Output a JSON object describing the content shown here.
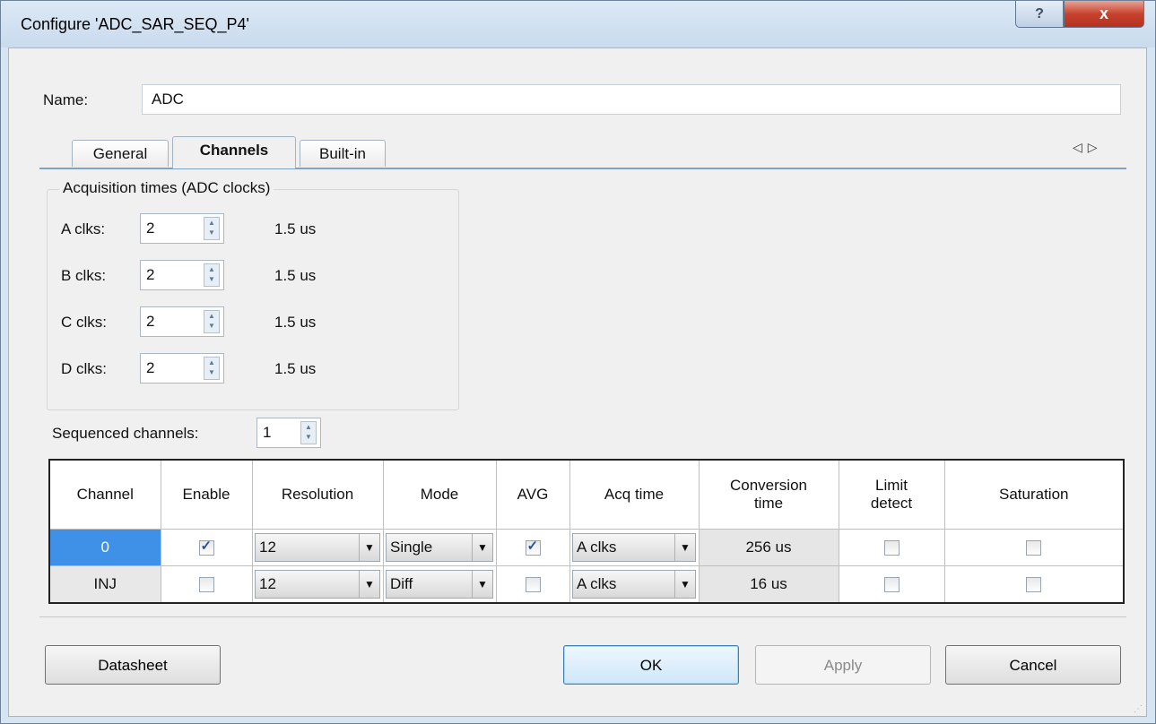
{
  "window": {
    "title": "Configure 'ADC_SAR_SEQ_P4'",
    "help_label": "?",
    "close_label": "x"
  },
  "name_row": {
    "label": "Name:",
    "value": "ADC"
  },
  "tabs": [
    {
      "label": "General"
    },
    {
      "label": "Channels",
      "active": true
    },
    {
      "label": "Built-in"
    }
  ],
  "tab_scroll": {
    "left": "◁",
    "right": "▷"
  },
  "acquisition": {
    "title": "Acquisition times (ADC clocks)",
    "rows": [
      {
        "label": "A clks:",
        "value": "2",
        "time": "1.5 us"
      },
      {
        "label": "B clks:",
        "value": "2",
        "time": "1.5 us"
      },
      {
        "label": "C clks:",
        "value": "2",
        "time": "1.5 us"
      },
      {
        "label": "D clks:",
        "value": "2",
        "time": "1.5 us"
      }
    ]
  },
  "sequenced": {
    "label": "Sequenced channels:",
    "value": "1"
  },
  "table": {
    "headers": [
      "Channel",
      "Enable",
      "Resolution",
      "Mode",
      "AVG",
      "Acq time",
      "Conversion time",
      "Limit detect",
      "Saturation"
    ],
    "rows": [
      {
        "channel": "0",
        "enable": true,
        "resolution": "12",
        "mode": "Single",
        "avg": true,
        "acq": "A clks",
        "conversion": "256 us",
        "limit": false,
        "saturation": false,
        "selected": true
      },
      {
        "channel": "INJ",
        "enable": false,
        "resolution": "12",
        "mode": "Diff",
        "avg": false,
        "acq": "A clks",
        "conversion": "16 us",
        "limit": false,
        "saturation": false
      }
    ]
  },
  "buttons": {
    "datasheet": "Datasheet",
    "ok": "OK",
    "apply": "Apply",
    "cancel": "Cancel"
  },
  "colors": {
    "selection": "#3f91e8",
    "title_bar": "#d7e4f2",
    "close_button": "#c7422e"
  }
}
